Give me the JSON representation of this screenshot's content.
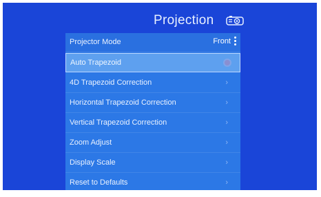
{
  "header": {
    "title": "Projection",
    "icon": "projector-icon"
  },
  "menu": {
    "mode_label": "Projector Mode",
    "mode_value": "Front",
    "items": [
      {
        "label": "Auto Trapezoid",
        "control": "toggle",
        "selected": true
      },
      {
        "label": "4D Trapezoid Correction",
        "control": "chevron"
      },
      {
        "label": "Horizontal Trapezoid Correction",
        "control": "chevron"
      },
      {
        "label": "Vertical Trapezoid Correction",
        "control": "chevron"
      },
      {
        "label": "Zoom Adjust",
        "control": "chevron"
      },
      {
        "label": "Display Scale",
        "control": "chevron"
      },
      {
        "label": "Reset to Defaults",
        "control": "chevron"
      }
    ],
    "chevron_glyph": "›"
  },
  "colors": {
    "background": "#1a45d8",
    "panel": "#2c78e6",
    "selected": "#5ea0ef"
  }
}
